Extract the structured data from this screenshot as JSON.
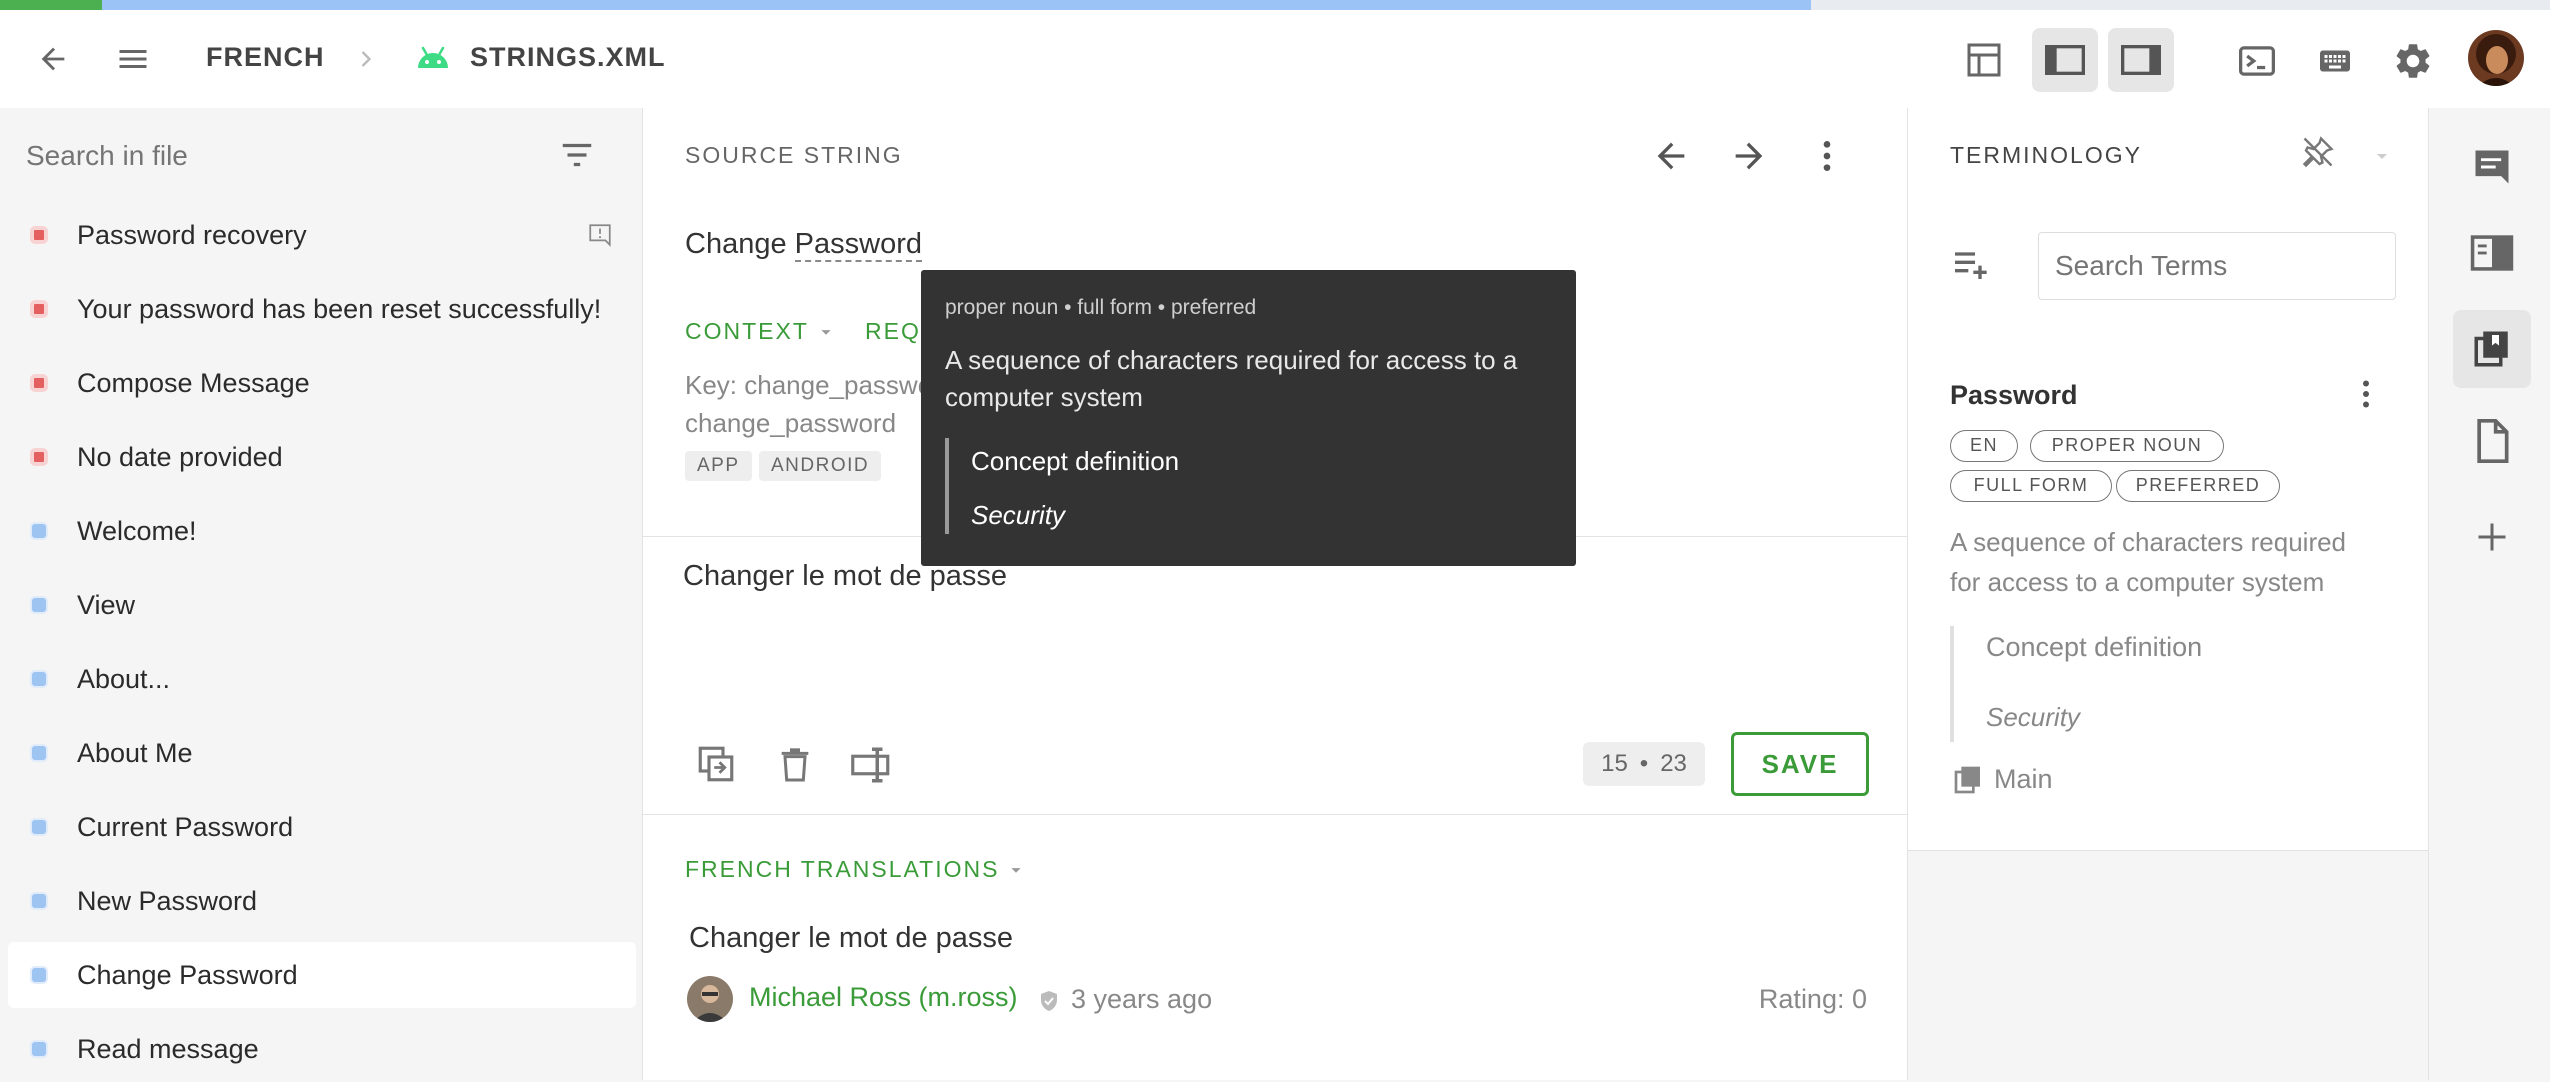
{
  "progress": {
    "translated": 0.04,
    "proofread": 0.71
  },
  "header": {
    "project": "FRENCH",
    "file": "STRINGS.XML"
  },
  "sidebar": {
    "search_placeholder": "Search in file",
    "items": [
      {
        "label": "Password recovery",
        "status": "untranslated"
      },
      {
        "label": "Your password has been reset successfully!",
        "status": "untranslated"
      },
      {
        "label": "Compose Message",
        "status": "untranslated"
      },
      {
        "label": "No date provided",
        "status": "untranslated"
      },
      {
        "label": "Welcome!",
        "status": "translated"
      },
      {
        "label": "View",
        "status": "translated"
      },
      {
        "label": "About...",
        "status": "translated"
      },
      {
        "label": "About Me",
        "status": "translated"
      },
      {
        "label": "Current Password",
        "status": "translated"
      },
      {
        "label": "New Password",
        "status": "translated"
      },
      {
        "label": "Change Password",
        "status": "translated",
        "selected": true
      },
      {
        "label": "Read message",
        "status": "translated"
      }
    ]
  },
  "editor": {
    "source_heading": "SOURCE STRING",
    "source_text_plain": "Change ",
    "source_text_term": "Password",
    "context_label": "CONTEXT",
    "request_label": "REQUEST",
    "key_line": "Key: change_password",
    "key_value": "change_password",
    "tags": [
      "APP",
      "ANDROID"
    ],
    "translation_value": "Changer le mot de passe",
    "counter_source": "15",
    "counter_separator": "•",
    "counter_target": "23",
    "save_label": "SAVE",
    "translations_heading": "FRENCH TRANSLATIONS",
    "suggestion": {
      "text": "Changer le mot de passe",
      "author": "Michael Ross (m.ross)",
      "time": "3 years ago",
      "rating": "Rating: 0"
    }
  },
  "tooltip": {
    "meta": "proper noun • full form • preferred",
    "definition": "A sequence of characters required for access to a computer system",
    "concept_label": "Concept definition",
    "concept_value": "Security"
  },
  "terminology": {
    "heading": "TERMINOLOGY",
    "search_placeholder": "Search Terms",
    "term": {
      "name": "Password",
      "pills": [
        "EN",
        "PROPER NOUN",
        "FULL FORM",
        "PREFERRED"
      ],
      "definition_line1": "A sequence of characters required",
      "definition_line2": "for access to a computer system",
      "concept_label": "Concept definition",
      "concept_value": "Security",
      "glossary": "Main"
    }
  },
  "colors": {
    "accent_green": "#3a9b38",
    "untranslated_red": "#e45f5f",
    "translated_blue": "#9ec4f2",
    "tooltip_bg": "#333333"
  }
}
